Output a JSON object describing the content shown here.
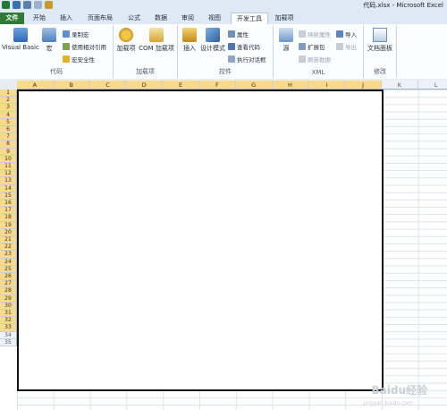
{
  "window": {
    "title": "代码.xlsx - Microsoft Excel"
  },
  "tabs": [
    "文件",
    "开始",
    "插入",
    "页面布局",
    "公式",
    "数据",
    "审阅",
    "视图",
    "开发工具",
    "加载项"
  ],
  "active_tab": "开发工具",
  "ribbon": {
    "code_group": {
      "title": "代码",
      "visual_basic": "Visual Basic",
      "macros": "宏",
      "record_macro": "录制宏",
      "relative_ref": "使用相对引用",
      "macro_security": "宏安全性"
    },
    "addins_group": {
      "title": "加载项",
      "addins": "加载项",
      "com_addins": "COM 加载项"
    },
    "controls_group": {
      "title": "控件",
      "insert": "插入",
      "design_mode": "设计模式",
      "properties": "属性",
      "view_code": "查看代码",
      "run_dialog": "执行对话框"
    },
    "xml_group": {
      "title": "XML",
      "source": "源",
      "map_properties": "映射属性",
      "expansion_packs": "扩展包",
      "refresh_data": "刷新数据",
      "import": "导入",
      "export": "导出"
    },
    "modify_group": {
      "title": "修改",
      "doc_panel": "文档面板"
    }
  },
  "columns": [
    "A",
    "B",
    "C",
    "D",
    "E",
    "F",
    "G",
    "H",
    "I",
    "J",
    "K",
    "L"
  ],
  "rows": [
    "1",
    "2",
    "3",
    "4",
    "5",
    "6",
    "7",
    "8",
    "9",
    "10",
    "11",
    "12",
    "13",
    "14",
    "15",
    "16",
    "17",
    "18",
    "19",
    "20",
    "21",
    "22",
    "23",
    "24",
    "25",
    "26",
    "27",
    "28",
    "29",
    "30",
    "31",
    "32",
    "33",
    "34",
    "35"
  ],
  "watermark": {
    "main": "Baidu经验",
    "sub": "jingyan.baidu.com"
  },
  "colors": {
    "accent": "#2f7a34",
    "selected_header": "#f9d98a",
    "ribbon_bg": "#dfe9f5"
  }
}
